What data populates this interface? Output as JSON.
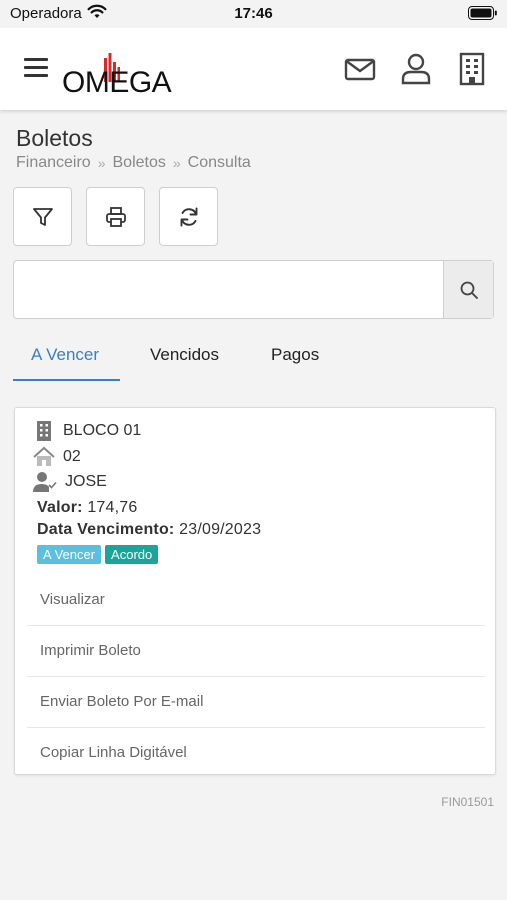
{
  "status_bar": {
    "carrier": "Operadora",
    "time": "17:46"
  },
  "header": {
    "logo_text": "OMEGA"
  },
  "page": {
    "title": "Boletos",
    "breadcrumb": [
      "Financeiro",
      "Boletos",
      "Consulta"
    ]
  },
  "search": {
    "value": "",
    "placeholder": ""
  },
  "tabs": [
    {
      "label": "A Vencer",
      "active": true
    },
    {
      "label": "Vencidos",
      "active": false
    },
    {
      "label": "Pagos",
      "active": false
    }
  ],
  "card": {
    "bloco": "BLOCO 01",
    "unidade": "02",
    "pessoa": "JOSE",
    "valor_label": "Valor:",
    "valor": "174,76",
    "vencimento_label": "Data Vencimento:",
    "vencimento": "23/09/2023",
    "badges": [
      {
        "label": "A Vencer",
        "color": "#5bc0de"
      },
      {
        "label": "Acordo",
        "color": "#1aa59a"
      }
    ],
    "actions": [
      "Visualizar",
      "Imprimir Boleto",
      "Enviar Boleto Por E-mail",
      "Copiar Linha Digitável"
    ]
  },
  "footer": {
    "code": "FIN01501"
  },
  "colors": {
    "accent": "#3a7fc1",
    "logo_red": "#d62b2b"
  }
}
